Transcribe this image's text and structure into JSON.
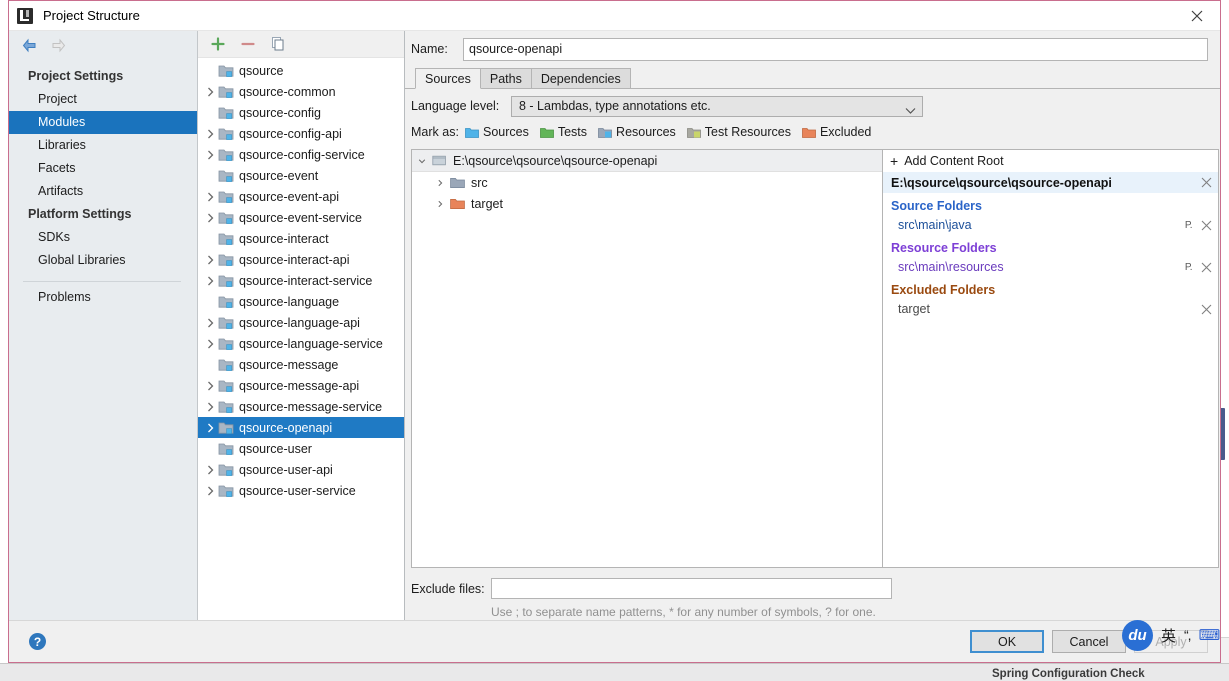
{
  "window": {
    "title": "Project Structure",
    "app_icon": "intellij-icon",
    "close_icon": "close-icon"
  },
  "nav": {
    "back_icon": "arrow-left-icon",
    "forward_icon": "arrow-right-icon"
  },
  "sidebar": {
    "groups": [
      {
        "label": "Project Settings",
        "items": [
          {
            "label": "Project",
            "selected": false
          },
          {
            "label": "Modules",
            "selected": true
          },
          {
            "label": "Libraries",
            "selected": false
          },
          {
            "label": "Facets",
            "selected": false
          },
          {
            "label": "Artifacts",
            "selected": false
          }
        ]
      },
      {
        "label": "Platform Settings",
        "items": [
          {
            "label": "SDKs",
            "selected": false
          },
          {
            "label": "Global Libraries",
            "selected": false
          }
        ]
      }
    ],
    "problems": {
      "label": "Problems"
    }
  },
  "modules_toolbar": {
    "add_icon": "plus-icon",
    "remove_icon": "minus-icon",
    "copy_icon": "copy-icon"
  },
  "modules": [
    {
      "label": "qsource",
      "expandable": false,
      "selected": false
    },
    {
      "label": "qsource-common",
      "expandable": true,
      "selected": false
    },
    {
      "label": "qsource-config",
      "expandable": false,
      "selected": false
    },
    {
      "label": "qsource-config-api",
      "expandable": true,
      "selected": false
    },
    {
      "label": "qsource-config-service",
      "expandable": true,
      "selected": false
    },
    {
      "label": "qsource-event",
      "expandable": false,
      "selected": false
    },
    {
      "label": "qsource-event-api",
      "expandable": true,
      "selected": false
    },
    {
      "label": "qsource-event-service",
      "expandable": true,
      "selected": false
    },
    {
      "label": "qsource-interact",
      "expandable": false,
      "selected": false
    },
    {
      "label": "qsource-interact-api",
      "expandable": true,
      "selected": false
    },
    {
      "label": "qsource-interact-service",
      "expandable": true,
      "selected": false
    },
    {
      "label": "qsource-language",
      "expandable": false,
      "selected": false
    },
    {
      "label": "qsource-language-api",
      "expandable": true,
      "selected": false
    },
    {
      "label": "qsource-language-service",
      "expandable": true,
      "selected": false
    },
    {
      "label": "qsource-message",
      "expandable": false,
      "selected": false
    },
    {
      "label": "qsource-message-api",
      "expandable": true,
      "selected": false
    },
    {
      "label": "qsource-message-service",
      "expandable": true,
      "selected": false
    },
    {
      "label": "qsource-openapi",
      "expandable": true,
      "selected": true
    },
    {
      "label": "qsource-user",
      "expandable": false,
      "selected": false
    },
    {
      "label": "qsource-user-api",
      "expandable": true,
      "selected": false
    },
    {
      "label": "qsource-user-service",
      "expandable": true,
      "selected": false
    }
  ],
  "form": {
    "name_label": "Name:",
    "name_value": "qsource-openapi",
    "tabs": [
      {
        "label": "Sources",
        "active": true
      },
      {
        "label": "Paths",
        "active": false
      },
      {
        "label": "Dependencies",
        "active": false
      }
    ],
    "language_level_label": "Language level:",
    "language_level_value": "8 - Lambdas, type annotations etc.",
    "mark_as_label": "Mark as:",
    "mark_as_options": [
      {
        "label": "Sources",
        "color": "#4fb3e8"
      },
      {
        "label": "Tests",
        "color": "#62b558"
      },
      {
        "label": "Resources",
        "color": "#9aa7b8"
      },
      {
        "label": "Test Resources",
        "color": "#a8a8a0"
      },
      {
        "label": "Excluded",
        "color": "#e8845a"
      }
    ]
  },
  "content_root_tree": {
    "root_label": "E:\\qsource\\qsource\\qsource-openapi",
    "children": [
      {
        "label": "src",
        "icon_color": "#9aa7b8",
        "expandable": true
      },
      {
        "label": "target",
        "icon_color": "#e8845a",
        "expandable": true
      }
    ]
  },
  "folders_panel": {
    "add_content_root_label": "Add Content Root",
    "add_icon": "plus-icon",
    "root_path": "E:\\qsource\\qsource\\qsource-openapi",
    "root_remove_icon": "close-icon",
    "groups": [
      {
        "title": "Source Folders",
        "color": "#2a64c8",
        "entries": [
          {
            "path": "src\\main\\java",
            "has_package_prefix": true
          }
        ]
      },
      {
        "title": "Resource Folders",
        "color": "#7d3fd6",
        "entries": [
          {
            "path": "src\\main\\resources",
            "has_package_prefix": true
          }
        ]
      },
      {
        "title": "Excluded Folders",
        "color": "#9a4a10",
        "entries": [
          {
            "path": "target",
            "has_package_prefix": false
          }
        ]
      }
    ]
  },
  "exclude": {
    "label": "Exclude files:",
    "value": "",
    "placeholder": "",
    "hint": "Use ; to separate name patterns, * for any number of symbols, ? for one."
  },
  "footer": {
    "help_label": "?",
    "ok_label": "OK",
    "cancel_label": "Cancel",
    "apply_label": "Apply"
  },
  "background": {
    "status_text": "Spring Configuration Check"
  },
  "ime": {
    "logo_text": "du",
    "mode": "英",
    "punctuation": "“,",
    "keyboard_icon": "keyboard-icon"
  }
}
